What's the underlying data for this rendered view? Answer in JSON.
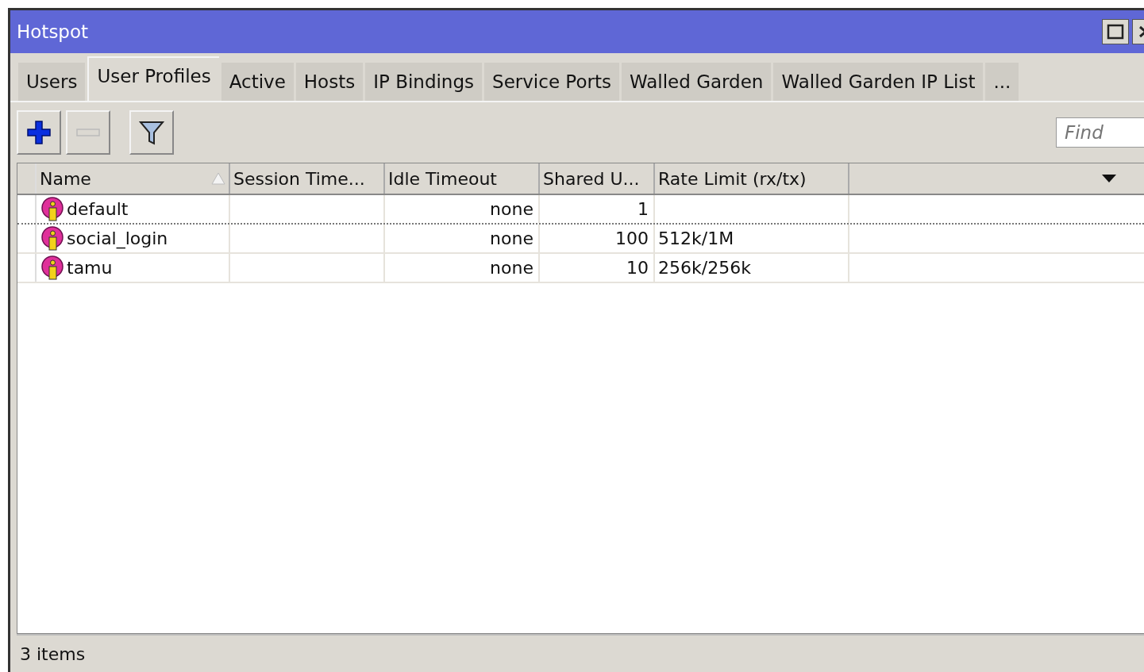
{
  "window": {
    "title": "Hotspot"
  },
  "tabs": [
    {
      "label": "Users",
      "selected": false
    },
    {
      "label": "User Profiles",
      "selected": true
    },
    {
      "label": "Active",
      "selected": false
    },
    {
      "label": "Hosts",
      "selected": false
    },
    {
      "label": "IP Bindings",
      "selected": false
    },
    {
      "label": "Service Ports",
      "selected": false
    },
    {
      "label": "Walled Garden",
      "selected": false
    },
    {
      "label": "Walled Garden IP List",
      "selected": false
    },
    {
      "label": "...",
      "selected": false
    }
  ],
  "toolbar": {
    "buttons": [
      {
        "kind": "add",
        "disabled": false
      },
      {
        "kind": "remove",
        "disabled": true
      },
      {
        "kind": "filter",
        "disabled": false
      }
    ],
    "search": {
      "placeholder": "Find"
    }
  },
  "table": {
    "columns": [
      "Name",
      "Session Time...",
      "Idle Timeout",
      "Shared U...",
      "Rate Limit (rx/tx)"
    ],
    "rows": [
      {
        "selected": true,
        "cells": [
          "default",
          "",
          "none",
          "1",
          ""
        ]
      },
      {
        "selected": false,
        "cells": [
          "social_login",
          "",
          "none",
          "100",
          "512k/1M"
        ]
      },
      {
        "selected": false,
        "cells": [
          "tamu",
          "",
          "none",
          "10",
          "256k/256k"
        ]
      }
    ]
  },
  "status_bar": "3 items"
}
